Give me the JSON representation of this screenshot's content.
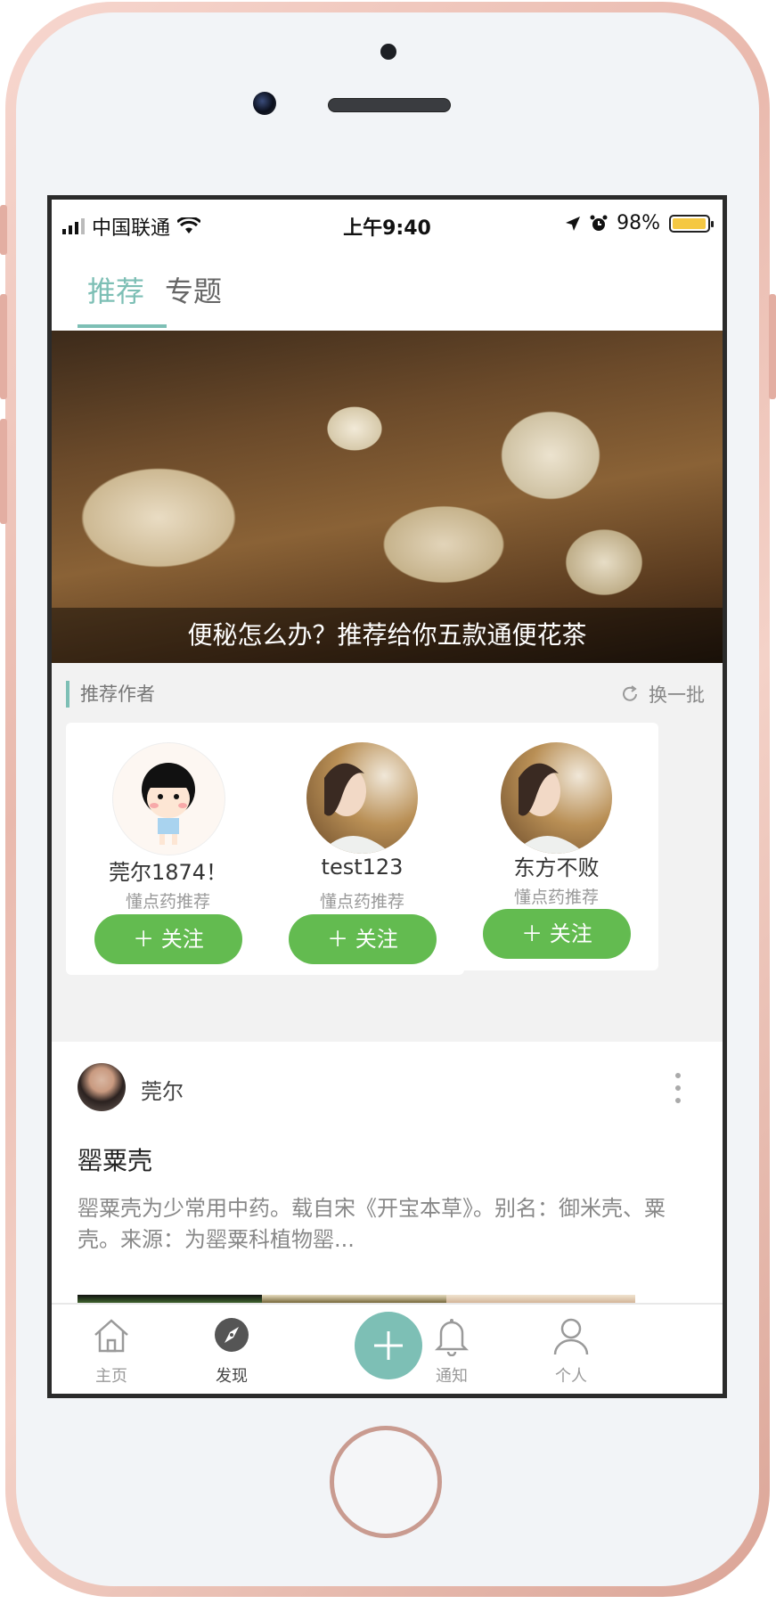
{
  "status_bar": {
    "carrier": "中国联通",
    "time": "上午9:40",
    "battery": "98%",
    "battery_level": 0.98
  },
  "tabs": [
    {
      "label": "推荐",
      "active": true
    },
    {
      "label": "专题",
      "active": false
    }
  ],
  "banner": {
    "caption": "便秘怎么办？推荐给你五款通便花茶"
  },
  "authors": {
    "heading": "推荐作者",
    "refresh_label": "换一批",
    "items": [
      {
        "name": "莞尔1874！",
        "desc": "懂点药推荐",
        "follow": "＋ 关注"
      },
      {
        "name": "test123",
        "desc": "懂点药推荐",
        "follow": "＋ 关注"
      },
      {
        "name": "东方不败",
        "desc": "懂点药推荐",
        "follow": "＋ 关注"
      }
    ]
  },
  "post": {
    "author": "莞尔",
    "title": "罂粟壳",
    "excerpt": "罂粟壳为少常用中药。载自宋《开宝本草》。别名：御米壳、粟壳。来源：为罂粟科植物罂..."
  },
  "tabbar": {
    "items": [
      {
        "label": "主页",
        "icon": "home-icon"
      },
      {
        "label": "发现",
        "icon": "compass-icon",
        "active": true
      },
      {
        "label": "",
        "icon": "plus-icon"
      },
      {
        "label": "通知",
        "icon": "bell-icon"
      },
      {
        "label": "个人",
        "icon": "person-icon"
      }
    ]
  },
  "colors": {
    "accent": "#7dbfb5",
    "follow_button": "#63bb50",
    "phone_frame": "#e9b9ad"
  }
}
